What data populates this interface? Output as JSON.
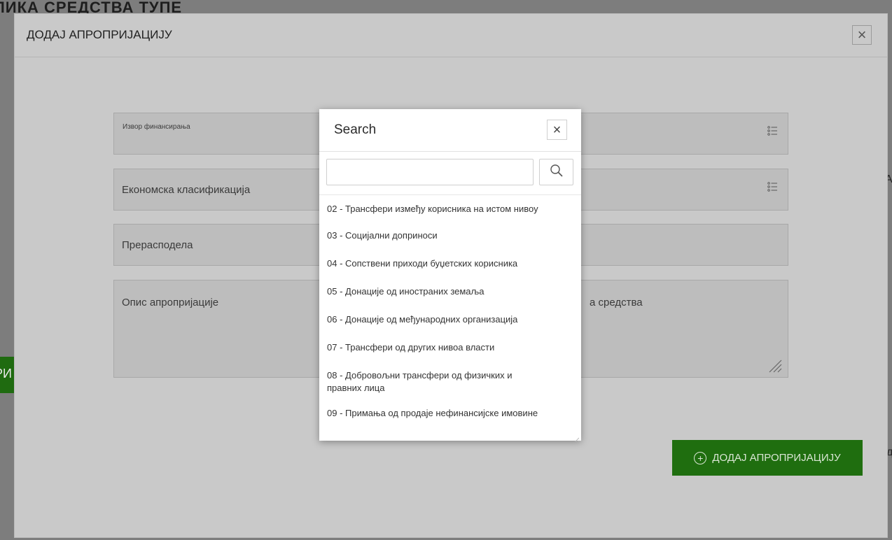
{
  "background": {
    "page_title_fragment": "...ЛИКА СРЕДСТВА ТУПЕ",
    "left_button_fragment": "РИ"
  },
  "modal": {
    "title": "ДОДАЈ АПРОПРИЈАЦИЈУ",
    "close_glyph": "×",
    "fields": {
      "funding_source_label": "Извор финансирања",
      "economic_classification_label": "Економска класификација",
      "reallocation_label": "Прерасподела",
      "description_label": "Опис апропријације",
      "description_right_fragment": "а средства"
    },
    "add_button_label": "ДОДАЈ АПРОПРИЈАЦИЈУ"
  },
  "search_popup": {
    "title": "Search",
    "close_glyph": "×",
    "input_value": "",
    "input_placeholder": "",
    "results": [
      "02 - Трансфери између корисника на истом нивоу",
      "03 - Социјални доприноси",
      "04 - Сопствени приходи буџетских корисника",
      "05 - Донације од иностраних земаља",
      "06 - Донације од међународних организација",
      "07 - Трансфери од других нивоа власти",
      "08 - Добровољни трансфери од физичких и правних лица",
      "09 - Примања од продаје нефинансијске имовине"
    ]
  },
  "colors": {
    "overlay": "#7d7d7d",
    "modal_bg": "#c9c9c9",
    "primary_green": "#1f6e0f",
    "popup_bg": "#ffffff"
  },
  "icons": [
    "close-icon",
    "list-icon",
    "search-icon",
    "plus-circle-icon",
    "resize-grip-icon"
  ]
}
